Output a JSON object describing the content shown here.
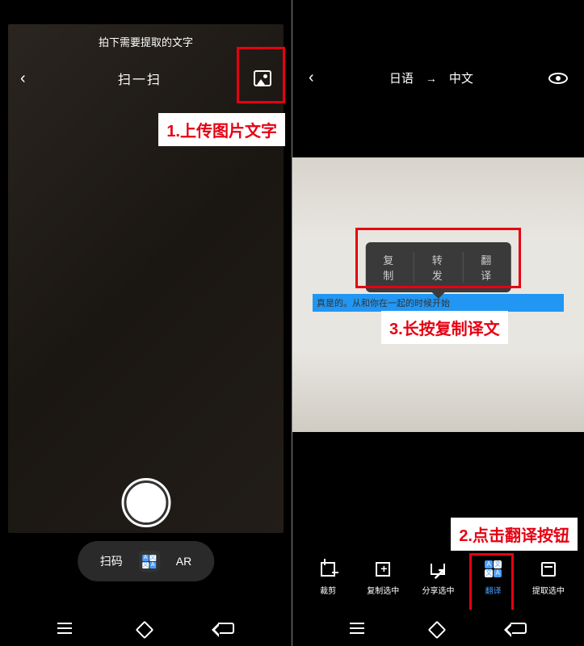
{
  "left": {
    "hint": "拍下需要提取的文字",
    "title": "扫一扫",
    "modes": {
      "scan_code": "扫码",
      "ar": "AR"
    }
  },
  "right": {
    "lang_from": "日语",
    "lang_to": "中文",
    "popup": {
      "copy": "复制",
      "forward": "转发",
      "translate": "翻译"
    },
    "translated_text": "真是的。从和你在一起的时候开始",
    "toolbar": {
      "crop": "裁剪",
      "copy_sel": "复制选中",
      "share_sel": "分享选中",
      "translate": "翻译",
      "extract_sel": "提取选中"
    }
  },
  "annotations": {
    "step1": "1.上传图片文字",
    "step2": "2.点击翻译按钮",
    "step3": "3.长按复制译文"
  }
}
